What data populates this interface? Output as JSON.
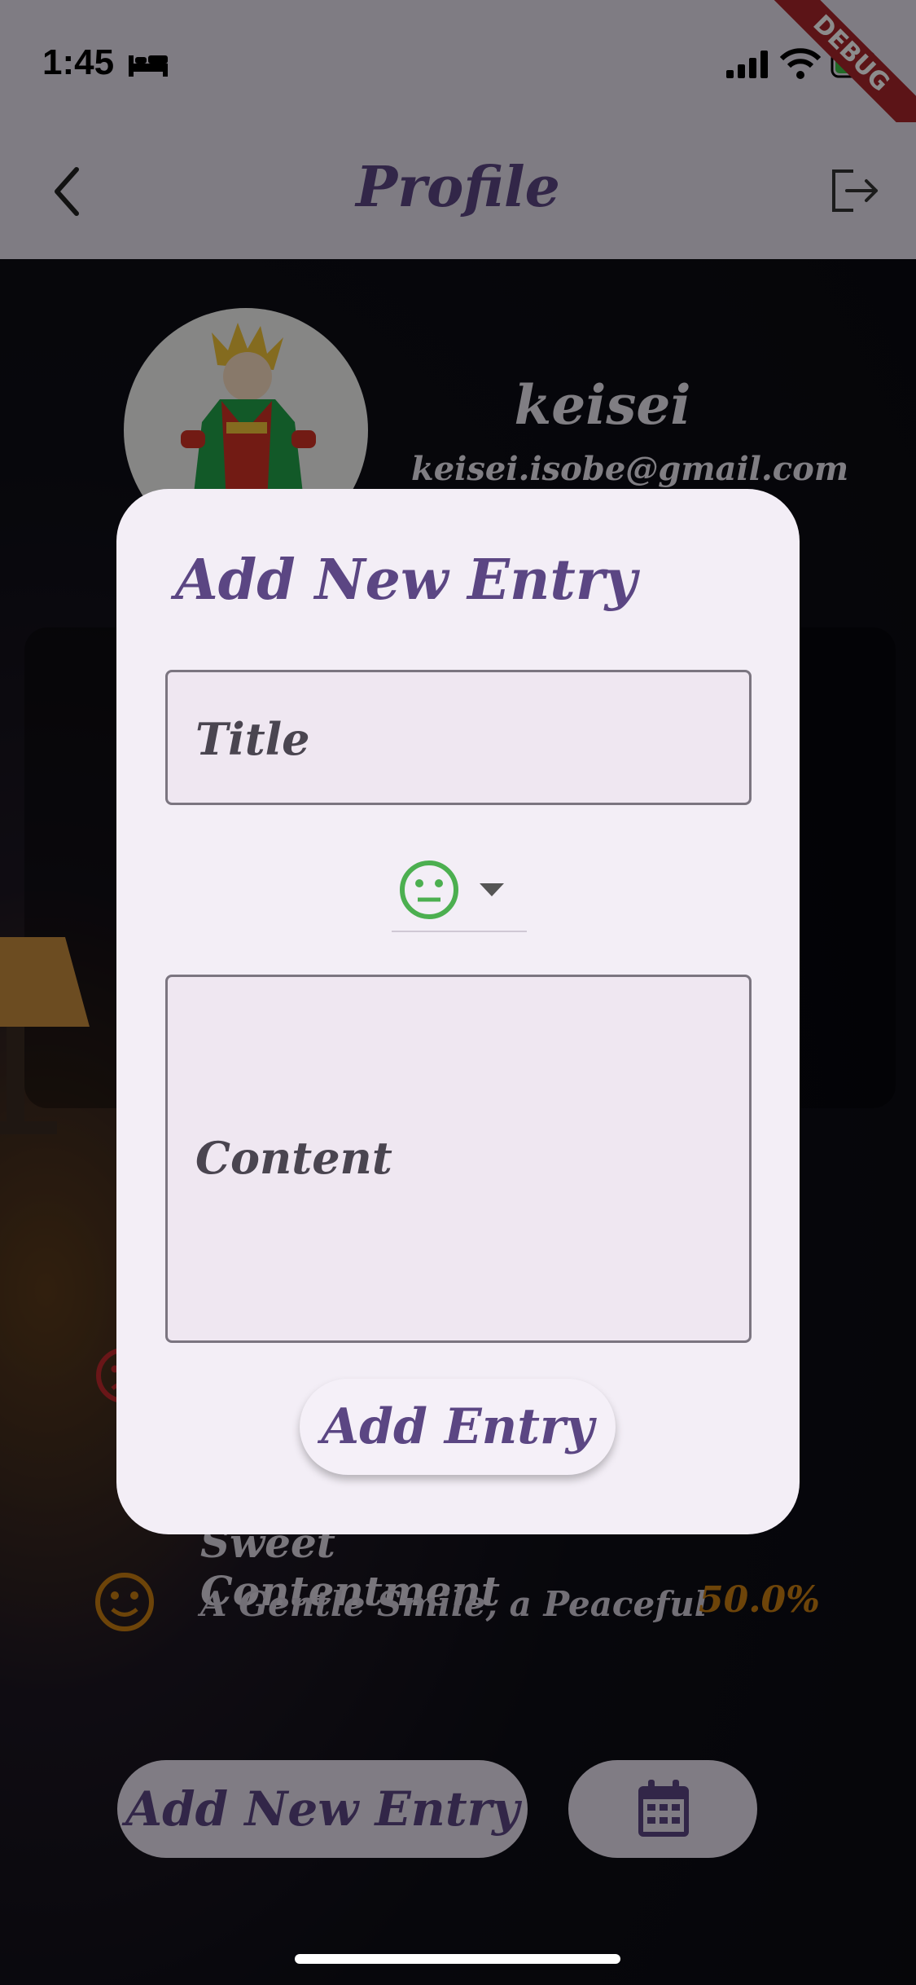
{
  "status_bar": {
    "time": "1:45"
  },
  "debug_banner": "DEBUG",
  "app_bar": {
    "title": "Profile"
  },
  "profile": {
    "username": "keisei",
    "email": "keisei.isobe@gmail.com"
  },
  "moods": [
    {
      "title": "Sweet Contentment",
      "subtitle": "A Gentle Smile, a Peaceful",
      "percent": "50.0%",
      "color": "#c77d12"
    }
  ],
  "bottom_bar": {
    "add_label": "Add New Entry"
  },
  "dialog": {
    "title": "Add New Entry",
    "title_placeholder": "Title",
    "content_placeholder": "Content",
    "mood_icon": "neutral-face-icon",
    "submit_label": "Add Entry"
  },
  "colors": {
    "accent": "#5b4683",
    "mood_neutral": "#4caf50",
    "mood_orange": "#c77d12",
    "mood_red": "#c0282c",
    "debug": "#a8262b"
  }
}
